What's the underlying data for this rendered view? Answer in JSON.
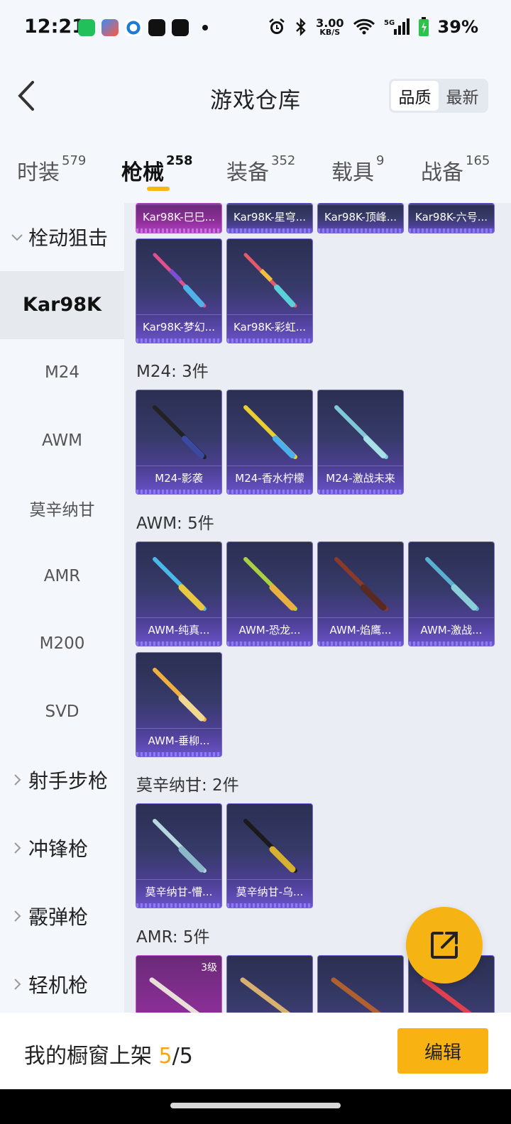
{
  "status_bar": {
    "time": "12:21",
    "net_speed": "3.00",
    "net_unit": "KB/S",
    "battery": "39%"
  },
  "header": {
    "title": "游戏仓库",
    "sort_options": [
      "品质",
      "最新"
    ]
  },
  "tabs": [
    {
      "label": "时装",
      "count": "579"
    },
    {
      "label": "枪械",
      "count": "258"
    },
    {
      "label": "装备",
      "count": "352"
    },
    {
      "label": "载具",
      "count": "9"
    },
    {
      "label": "战备",
      "count": "165"
    }
  ],
  "sidebar": {
    "group_expanded": "栓动狙击",
    "items": [
      "Kar98K",
      "M24",
      "AWM",
      "莫辛纳甘",
      "AMR",
      "M200",
      "SVD"
    ],
    "groups_collapsed": [
      "射手步枪",
      "冲锋枪",
      "霰弹枪",
      "轻机枪"
    ]
  },
  "sections": {
    "kar98k_top": [
      "Kar98K-巳巳...",
      "Kar98K-星穹...",
      "Kar98K-顶峰...",
      "Kar98K-六号..."
    ],
    "kar98k_row": [
      "Kar98K-梦幻...",
      "Kar98K-彩虹..."
    ],
    "m24": {
      "title": "M24: 3件",
      "items": [
        "M24-影袭",
        "M24-香水柠檬",
        "M24-激战未来"
      ]
    },
    "awm": {
      "title": "AWM: 5件",
      "items": [
        "AWM-纯真...",
        "AWM-恐龙...",
        "AWM-焰鹰...",
        "AWM-激战...",
        "AWM-垂柳..."
      ]
    },
    "mosin": {
      "title": "莫辛纳甘: 2件",
      "items": [
        "莫辛纳甘-懵...",
        "莫辛纳甘-乌..."
      ]
    },
    "amr": {
      "title": "AMR: 5件",
      "first_level": "3级"
    }
  },
  "bottom": {
    "showcase_label": "我的橱窗上架",
    "current": "5",
    "total": "/5",
    "edit_label": "编辑"
  },
  "colors": {
    "accent": "#f5b314",
    "card_purple": "#4c3f93",
    "card_magenta": "#8f2f9a"
  }
}
